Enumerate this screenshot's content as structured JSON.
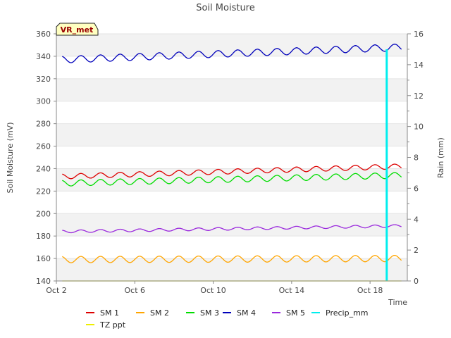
{
  "chart_data": {
    "type": "line",
    "title": "Soil Moisture",
    "site_badge": "VR_met",
    "xlabel": "Time",
    "ylabel_left": "Soil Moisture (mV)",
    "ylabel_right": "Rain (mm)",
    "x_ticks": [
      "Oct 2",
      "Oct 6",
      "Oct 10",
      "Oct 14",
      "Oct 18"
    ],
    "x_tick_days": [
      2,
      6,
      10,
      14,
      18
    ],
    "xlim_days": [
      2,
      19.9
    ],
    "ylim_left": [
      140,
      360
    ],
    "y_ticks_left": [
      140,
      160,
      180,
      200,
      220,
      240,
      260,
      280,
      300,
      320,
      340,
      360
    ],
    "ylim_right": [
      0,
      16
    ],
    "y_ticks_right": [
      0,
      2,
      4,
      6,
      8,
      10,
      12,
      14,
      16
    ],
    "grid": "horizontal bands",
    "legend_position": "bottom",
    "series": [
      {
        "name": "SM 1",
        "color": "#dd0000",
        "axis": "left",
        "x_start": 2.3,
        "x_end": 19.6,
        "start": 233,
        "end": 242,
        "amplitude": 2.2,
        "period_days": 1
      },
      {
        "name": "SM 2",
        "color": "#ffa500",
        "axis": "left",
        "x_start": 2.3,
        "x_end": 19.6,
        "start": 159,
        "end": 160,
        "amplitude": 2.8,
        "period_days": 1
      },
      {
        "name": "SM 3",
        "color": "#00dd00",
        "axis": "left",
        "x_start": 2.3,
        "x_end": 19.6,
        "start": 227,
        "end": 234,
        "amplitude": 2.6,
        "period_days": 1
      },
      {
        "name": "SM 4",
        "color": "#0000bb",
        "axis": "left",
        "x_start": 2.3,
        "x_end": 19.6,
        "start": 337,
        "end": 348,
        "amplitude": 3.0,
        "period_days": 1
      },
      {
        "name": "SM 5",
        "color": "#9a28dd",
        "axis": "left",
        "x_start": 2.3,
        "x_end": 19.6,
        "start": 184,
        "end": 189,
        "amplitude": 1.2,
        "period_days": 1
      },
      {
        "name": "Precip_mm",
        "color": "#00eeee",
        "axis": "right",
        "x_start": 18.85,
        "x_end": 18.85,
        "start": 15.0,
        "end": 15.0,
        "amplitude": 0,
        "period_days": 1
      },
      {
        "name": "TZ ppt",
        "color": "#eeee00",
        "axis": "right",
        "x_start": 2.3,
        "x_end": 19.6,
        "start": 0,
        "end": 0,
        "amplitude": 0,
        "period_days": 1
      }
    ]
  }
}
